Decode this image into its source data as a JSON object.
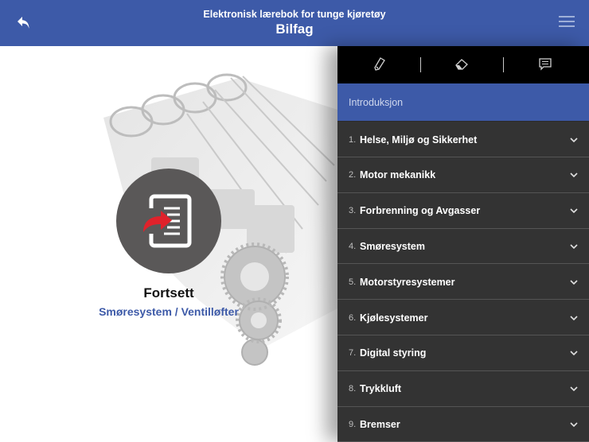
{
  "header": {
    "subtitle": "Elektronisk lærebok for tunge kjøretøy",
    "title": "Bilfag",
    "back_icon": "back-arrow-icon",
    "menu_icon": "hamburger-menu-icon",
    "bg_color": "#3d5aa8"
  },
  "continue": {
    "label": "Fortsett",
    "sub_label": "Smøresystem / Ventilløfter",
    "icon": "resume-document-icon",
    "accent": "#e0222b"
  },
  "toolbar": {
    "tools": [
      "pencil-icon",
      "eraser-icon",
      "comment-icon"
    ]
  },
  "sidebar": {
    "intro": "Introduksjon",
    "items": [
      {
        "num": "1.",
        "label": "Helse, Miljø og Sikkerhet"
      },
      {
        "num": "2.",
        "label": "Motor mekanikk"
      },
      {
        "num": "3.",
        "label": "Forbrenning og Avgasser"
      },
      {
        "num": "4.",
        "label": "Smøresystem"
      },
      {
        "num": "5.",
        "label": "Motorstyresystemer"
      },
      {
        "num": "6.",
        "label": "Kjølesystemer"
      },
      {
        "num": "7.",
        "label": "Digital styring"
      },
      {
        "num": "8.",
        "label": "Trykkluft"
      },
      {
        "num": "9.",
        "label": "Bremser"
      }
    ],
    "chevron_icon": "chevron-down-icon"
  }
}
